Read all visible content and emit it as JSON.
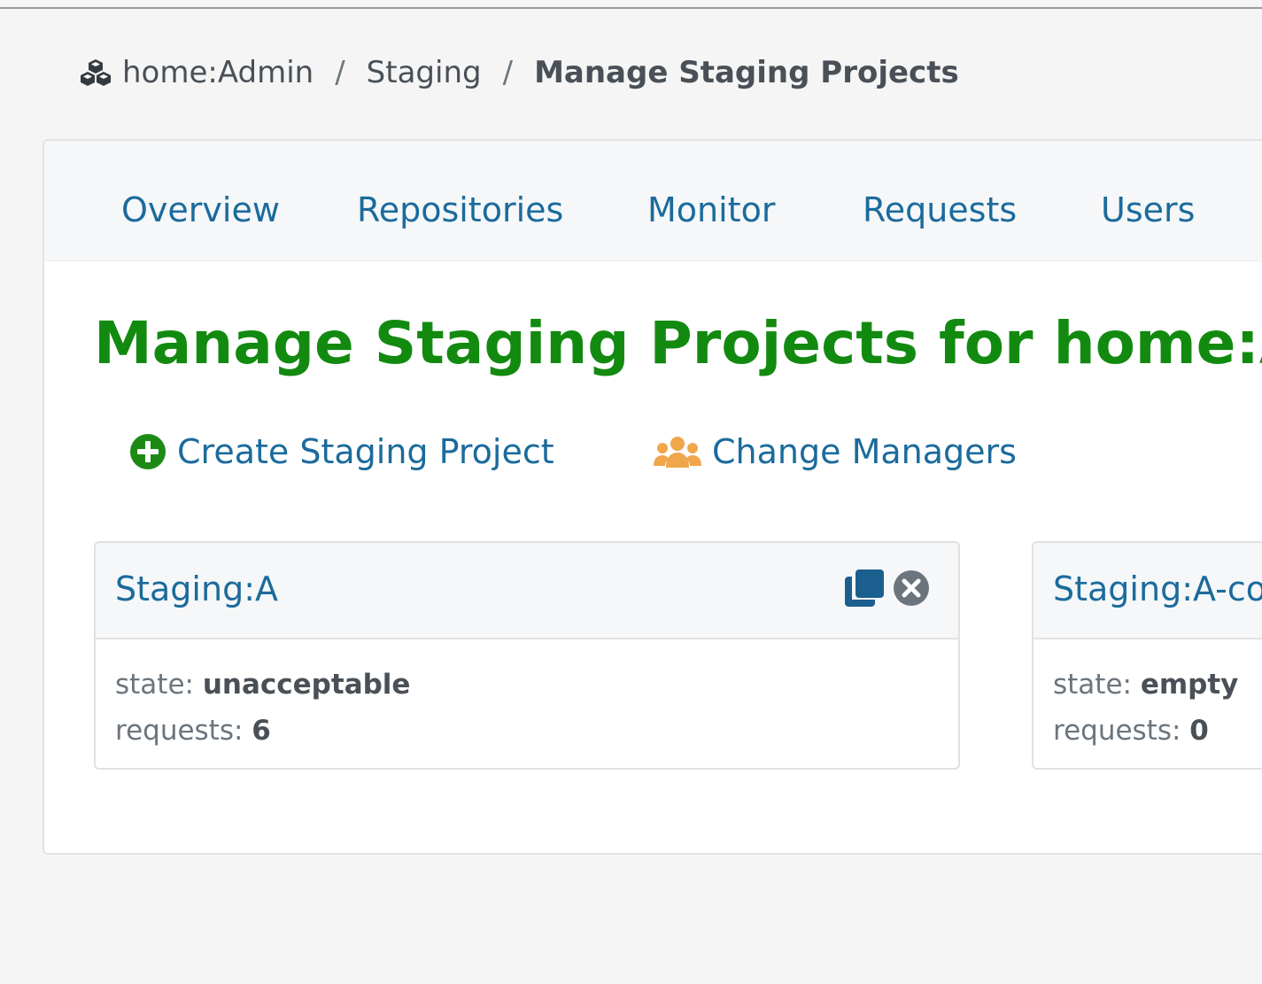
{
  "breadcrumb": {
    "icon": "cubes-icon",
    "items": [
      "home:Admin",
      "Staging",
      "Manage Staging Projects"
    ],
    "separator": "/"
  },
  "tabs": [
    "Overview",
    "Repositories",
    "Monitor",
    "Requests",
    "Users"
  ],
  "page_title": "Manage Staging Projects for home:Admin",
  "actions": {
    "create": {
      "label": "Create Staging Project",
      "icon": "plus-circle-icon",
      "color": "#1d8a16"
    },
    "managers": {
      "label": "Change Managers",
      "icon": "users-icon",
      "color": "#f0a64b"
    }
  },
  "projects": [
    {
      "name": "Staging:A",
      "state_label": "state:",
      "state": "unacceptable",
      "requests_label": "requests:",
      "requests": "6"
    },
    {
      "name": "Staging:A-co",
      "state_label": "state:",
      "state": "empty",
      "requests_label": "requests:",
      "requests": "0"
    }
  ],
  "colors": {
    "link": "#1b6b9c",
    "title_green": "#128a10",
    "background": "#f5f5f5"
  }
}
